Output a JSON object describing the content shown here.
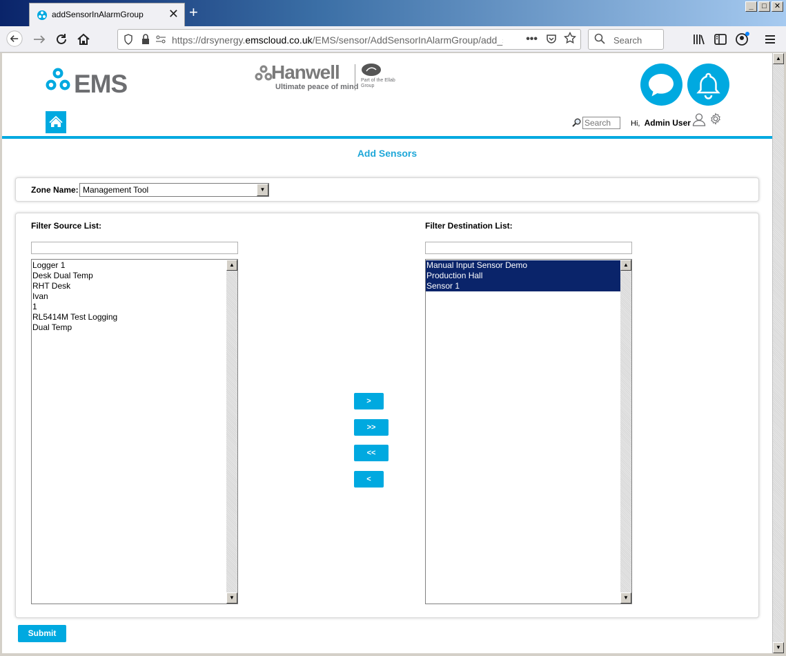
{
  "browser": {
    "tab_title": "addSensorInAlarmGroup",
    "new_tab_glyph": "+",
    "close_glyph": "✕",
    "window_controls": [
      "_",
      "□",
      "✕"
    ],
    "url_prefix": "https://drsynergy.",
    "url_domain": "emscloud.co.uk",
    "url_path": "/EMS/sensor/AddSensorInAlarmGroup/add_senso",
    "search_placeholder": "Search",
    "icons": [
      "back-arrow-icon",
      "forward-arrow-icon",
      "reload-icon",
      "home-icon",
      "library-icon",
      "sidebar-icon",
      "account-icon",
      "menu-icon"
    ]
  },
  "header": {
    "ems_logo_text": "EMS",
    "hanwell_name": "Hanwell",
    "hanwell_tagline": "Ultimate peace of mind",
    "ellab_text": "Part of the Ellab Group",
    "search_placeholder": "Search",
    "greeting_prefix": "Hi,",
    "user_name": "Admin User"
  },
  "page": {
    "title": "Add Sensors",
    "zone_label": "Zone Name:",
    "zone_value": "Management Tool",
    "source_label": "Filter Source List:",
    "destination_label": "Filter Destination List:",
    "source_items": [
      "Logger 1",
      "Desk Dual Temp",
      "RHT Desk",
      "Ivan",
      "1",
      "RL5414M Test Logging",
      "Dual Temp"
    ],
    "destination_items": [
      "Manual Input Sensor Demo",
      "Production Hall",
      "Sensor 1"
    ],
    "buttons": {
      "move_right": ">",
      "move_all_right": ">>",
      "move_all_left": "<<",
      "move_left": "<",
      "submit": "Submit"
    }
  },
  "colors": {
    "accent": "#00a9e0",
    "selection": "#0a246a"
  }
}
